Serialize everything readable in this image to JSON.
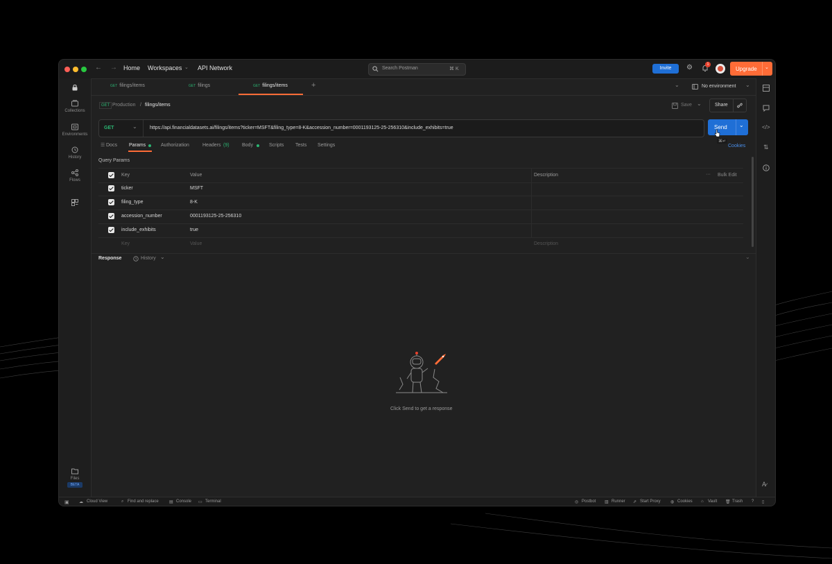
{
  "nav": {
    "home": "Home",
    "workspaces": "Workspaces",
    "api_network": "API Network"
  },
  "search": {
    "placeholder": "Search Postman",
    "shortcut": "⌘ K"
  },
  "header": {
    "invite": "Invite",
    "notification_count": "1",
    "upgrade": "Upgrade"
  },
  "tabs": [
    {
      "method": "GET",
      "label": "filings/items"
    },
    {
      "method": "GET",
      "label": "filings"
    },
    {
      "method": "GET",
      "label": "filings/items"
    }
  ],
  "environment": "No environment",
  "sidebar": {
    "collections": "Collections",
    "environments": "Environments",
    "history": "History",
    "flows": "Flows",
    "files": "Files",
    "beta": "BETA"
  },
  "breadcrumb": {
    "collection": "Production",
    "separator": "/",
    "request": "filings/items"
  },
  "actions": {
    "save": "Save",
    "share": "Share"
  },
  "request": {
    "method": "GET",
    "url": "https://api.financialdatasets.ai/filings/items?ticker=MSFT&filing_type=8-K&accession_number=0001193125-25-256310&include_exhibits=true",
    "send": "Send",
    "shortcut": "⌘↵",
    "cookies": "Cookies"
  },
  "subtabs": {
    "docs": "Docs",
    "params": "Params",
    "authorization": "Authorization",
    "headers": "Headers",
    "headers_count": "(9)",
    "body": "Body",
    "scripts": "Scripts",
    "tests": "Tests",
    "settings": "Settings"
  },
  "params": {
    "title": "Query Params",
    "headers": {
      "key": "Key",
      "value": "Value",
      "description": "Description",
      "bulk_edit": "Bulk Edit"
    },
    "rows": [
      {
        "key": "ticker",
        "value": "MSFT"
      },
      {
        "key": "filing_type",
        "value": "8-K"
      },
      {
        "key": "accession_number",
        "value": "0001193125-25-256310"
      },
      {
        "key": "include_exhibits",
        "value": "true"
      }
    ],
    "placeholders": {
      "key": "Key",
      "value": "Value",
      "description": "Description"
    }
  },
  "response": {
    "title": "Response",
    "history": "History",
    "empty_text": "Click Send to get a response"
  },
  "statusbar": {
    "cloud_view": "Cloud View",
    "find_replace": "Find and replace",
    "console": "Console",
    "terminal": "Terminal",
    "postbot": "Postbot",
    "runner": "Runner",
    "start_proxy": "Start Proxy",
    "cookies": "Cookies",
    "vault": "Vault",
    "trash": "Trash"
  },
  "colors": {
    "accent_blue": "#1f6fd6",
    "upgrade_orange": "#ff6c37",
    "get_green": "#2bb673",
    "window_bg": "#212121"
  }
}
